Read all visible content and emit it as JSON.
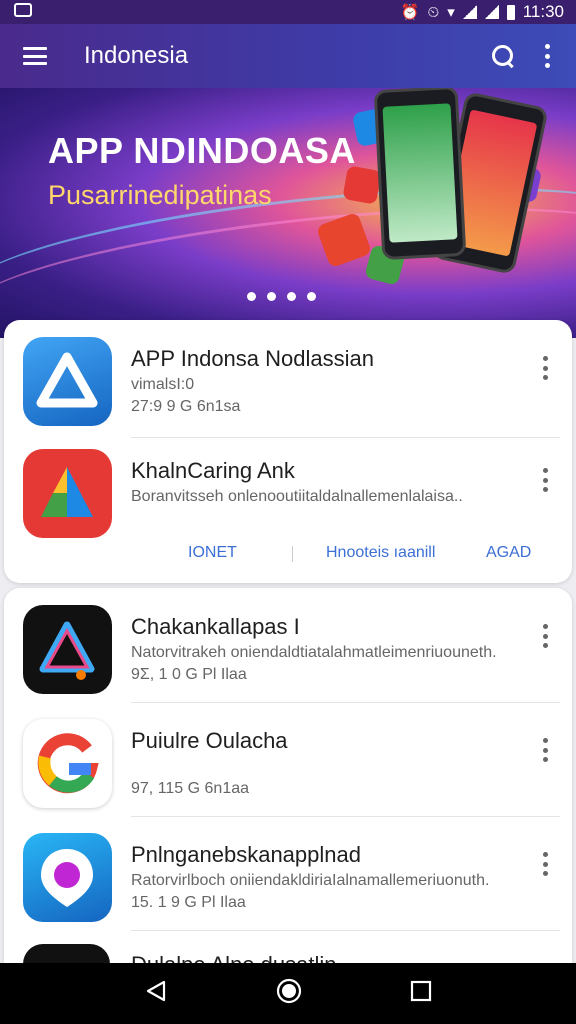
{
  "status_bar": {
    "time": "11:30",
    "icons": [
      "gallery-icon",
      "alarm-icon",
      "wifi-icon",
      "signal-icon",
      "battery-icon"
    ]
  },
  "app_bar": {
    "title": "Indonesia",
    "icons": [
      "menu-icon",
      "search-icon",
      "more-vert-icon"
    ]
  },
  "banner": {
    "title": "APP NDINDOASA",
    "subtitle": "Pusarrinedipatinas",
    "page_dots": 4,
    "colors": {
      "deep": "#231466",
      "mid": "#7a3dc8",
      "glow": "#f5b945",
      "subtitle": "#ffd76a"
    }
  },
  "card_one": {
    "apps": [
      {
        "name": "APP Indonsa Nodlassian",
        "line2": "vimalsI:0",
        "line3": "27:9 9  G 6n1sa",
        "icon": "blue-triangle-logo-icon",
        "icon_bg": "#1e88e5"
      },
      {
        "name": "KhalnCaring Ank",
        "line2": "Boranvitsseh onlenooutiitaldalnallemenlalaisa..",
        "line3": "",
        "icon": "multicolor-triangle-logo-icon",
        "icon_bg": "#e53935"
      }
    ],
    "actions": [
      "IONET",
      "Hnooteis ıaanill",
      "AGAD"
    ],
    "accent": "#3b6fd6"
  },
  "card_two": {
    "apps": [
      {
        "name": "Chakankallapas I",
        "line2": "Natorvitrakeh oniendaldtiatalahmatleimenriuouneth.",
        "line3": "9Σ, 1 0  G Pl Ilaa",
        "icon": "neon-triangle-logo-icon",
        "icon_bg": "#111111"
      },
      {
        "name": "Puiulre Oulacha",
        "line2": "",
        "line3": "97, 115  G 6n1aa",
        "icon": "google-g-logo-icon",
        "icon_bg": "#ffffff"
      },
      {
        "name": "Pnlnganebskanapplnad",
        "line2": "Ratorvirlboch oniiendakldiriaIalnamallemeriuonuth.",
        "line3": "15. 1 9  G Pl Ilaa",
        "icon": "location-pin-logo-icon",
        "icon_bg": "#1e88e5"
      }
    ],
    "peek_text": "Dulalpe Alne dusatlin"
  },
  "nav_bar": {
    "icons": [
      "back-icon",
      "home-icon",
      "recents-icon"
    ]
  }
}
